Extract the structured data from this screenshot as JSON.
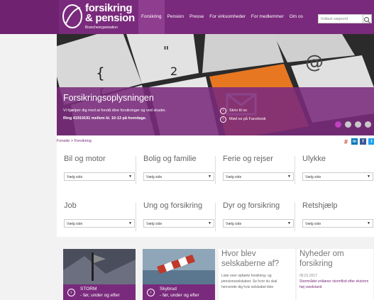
{
  "logo": {
    "line1": "forsikring",
    "line2": "& pension",
    "sub": "Brancheorganisation"
  },
  "nav": {
    "items": [
      {
        "label": "Forsikring",
        "active": true
      },
      {
        "label": "Pension",
        "active": false
      },
      {
        "label": "Presse",
        "active": false
      },
      {
        "label": "For virksomheder",
        "active": false
      },
      {
        "label": "For medlemmer",
        "active": false
      },
      {
        "label": "Om os",
        "active": false
      }
    ]
  },
  "search": {
    "placeholder": "Indtast søgeord",
    "icon": "search-icon"
  },
  "hero": {
    "title": "Forsikringsoplysningen",
    "desc1": "Vi hjælper dig med at forstå dine forsikringer og ved skader.",
    "desc2": "Ring 41919191 mellem kl. 10-13 på hverdage.",
    "link1": "Skriv til os",
    "link2": "Mød os på Facebook",
    "dots": 4,
    "active_dot": 0
  },
  "breadcrumb": {
    "home": "Forside",
    "sep": " > ",
    "current": "Forsikring"
  },
  "share": {
    "icons": [
      "print-icon-hash",
      "linkedin-icon",
      "facebook-icon",
      "twitter-icon",
      "email-icon"
    ]
  },
  "categories": [
    {
      "title": "Bil og motor",
      "select": "Vælg side"
    },
    {
      "title": "Bolig og familie",
      "select": "Vælg side"
    },
    {
      "title": "Ferie og rejser",
      "select": "Vælg side"
    },
    {
      "title": "Ulykke",
      "select": "Vælg side"
    },
    {
      "title": "Job",
      "select": "Vælg side"
    },
    {
      "title": "Ung og forsikring",
      "select": "Vælg side"
    },
    {
      "title": "Dyr og forsikring",
      "select": "Vælg side"
    },
    {
      "title": "Retshjælp",
      "select": "Vælg side"
    }
  ],
  "cards": [
    {
      "title": "STORM",
      "sub": "- før, under og efter"
    },
    {
      "title": "Skybrud",
      "sub": "- før, under og efter"
    }
  ],
  "mid_column": {
    "title": "Hvor blev selskaberne af?",
    "text": "Liste over ophørte forsikring- og pensionsselskaber. Se hvor du skal henvende dig hvis selskabet ikke"
  },
  "news": {
    "title": "Nyheder om forsikring",
    "date": "05.01.2017",
    "headline": "Stormrådet erklærer stormflod efter ekstrem høj vandstand"
  },
  "colors": {
    "brand": "#7a2a7c",
    "active_dot": "#c040c0"
  }
}
